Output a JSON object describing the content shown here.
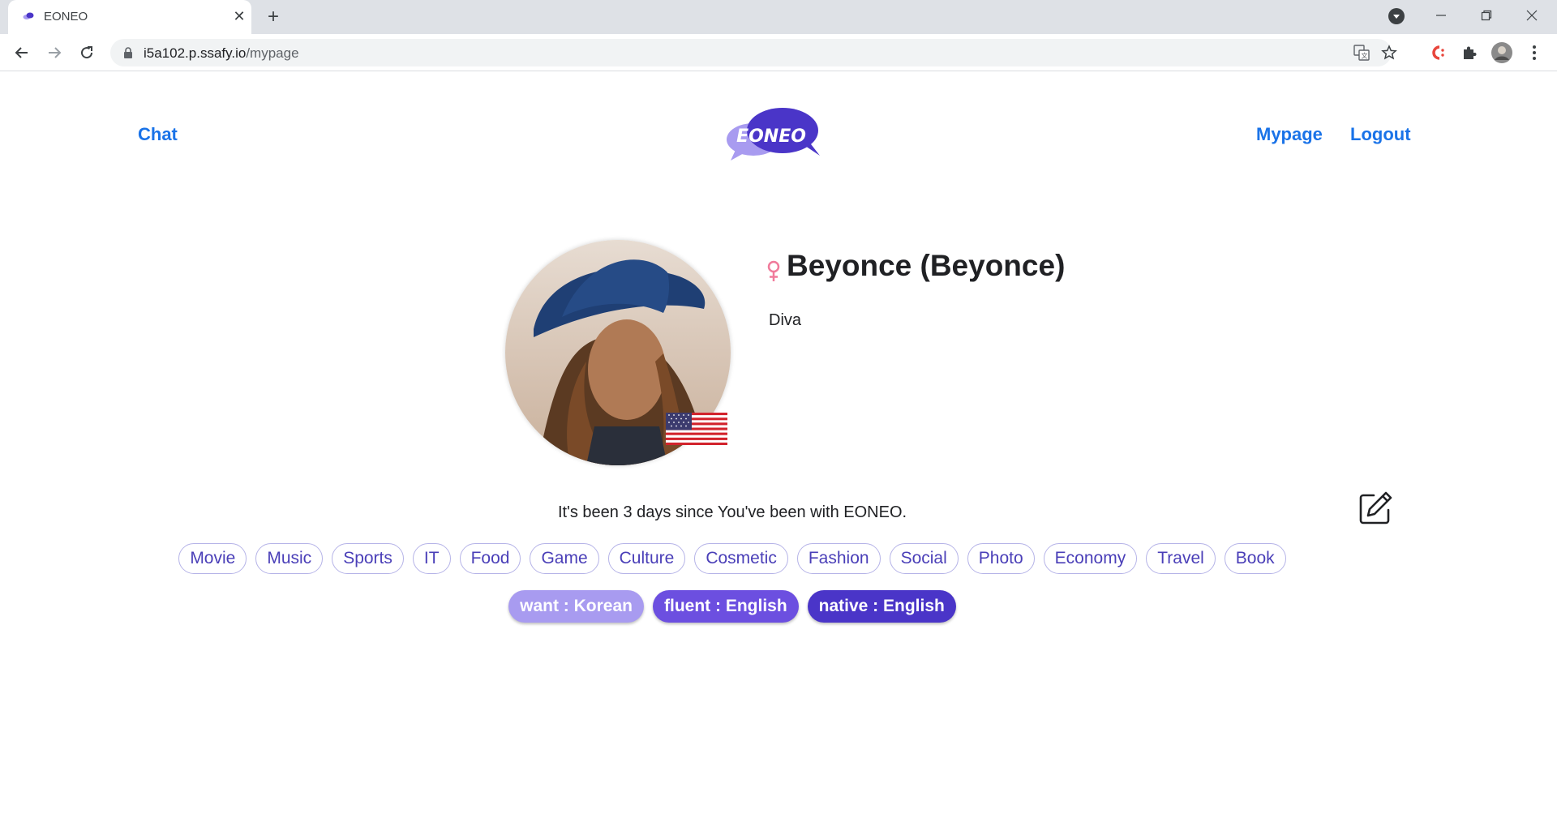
{
  "browser": {
    "tab_title": "EONEO",
    "tab_close": "✕",
    "new_tab": "+",
    "url_host": "i5a102.p.ssafy.io",
    "url_path": "/mypage"
  },
  "nav": {
    "left_link": "Chat",
    "right_links": [
      "Mypage",
      "Logout"
    ],
    "logo_text": "EONEO"
  },
  "profile": {
    "gender_symbol": "♀",
    "name": "Beyonce (Beyonce)",
    "bio": "Diva",
    "country_flag": "us-flag-icon",
    "since_text": "It's been 3 days since You've been with EONEO."
  },
  "interests": [
    "Movie",
    "Music",
    "Sports",
    "IT",
    "Food",
    "Game",
    "Culture",
    "Cosmetic",
    "Fashion",
    "Social",
    "Photo",
    "Economy",
    "Travel",
    "Book"
  ],
  "languages": {
    "want": "want : Korean",
    "fluent": "fluent : English",
    "native": "native : English"
  },
  "colors": {
    "link": "#1a73e8",
    "brand_dark": "#4a35c8",
    "brand_mid": "#6c4fe0",
    "brand_light": "#a89bf0",
    "gender": "#f07b9b"
  }
}
